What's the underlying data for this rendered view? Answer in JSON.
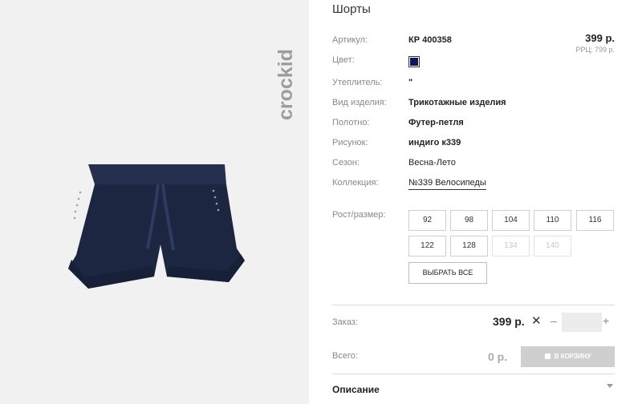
{
  "product": {
    "title": "Шорты",
    "brand_logo_text": "crockid",
    "price": "399 р.",
    "rrp": "РРЦ: 799 р.",
    "color_swatch": "#14145c",
    "image_color": "#1d2640"
  },
  "attributes": [
    {
      "label": "Артикул:",
      "value": "КР 400358"
    },
    {
      "label": "Цвет:",
      "value": ""
    },
    {
      "label": "Утеплитель:",
      "value": "\""
    },
    {
      "label": "Вид изделия:",
      "value": "Трикотажные изделия"
    },
    {
      "label": "Полотно:",
      "value": "Футер-петля"
    },
    {
      "label": "Рисунок:",
      "value": "индиго к339"
    },
    {
      "label": "Сезон:",
      "value": "Весна-Лето"
    },
    {
      "label": "Коллекция:",
      "value": "№339 Велосипеды"
    }
  ],
  "sizes": {
    "label": "Рост/размер:",
    "options": [
      {
        "label": "92",
        "available": true
      },
      {
        "label": "98",
        "available": true
      },
      {
        "label": "104",
        "available": true
      },
      {
        "label": "110",
        "available": true
      },
      {
        "label": "116",
        "available": true
      },
      {
        "label": "122",
        "available": true
      },
      {
        "label": "128",
        "available": true
      },
      {
        "label": "134",
        "available": false
      },
      {
        "label": "140",
        "available": false
      }
    ],
    "select_all_label": "ВЫБРАТЬ ВСЕ"
  },
  "order": {
    "label": "Заказ:",
    "price": "399 р.",
    "times": "✕",
    "minus": "–",
    "plus": "+",
    "quantity": ""
  },
  "total": {
    "label": "Всего:",
    "value": "0 р.",
    "cart_button": "В КОРЗИНУ"
  },
  "description": {
    "label": "Описание"
  }
}
